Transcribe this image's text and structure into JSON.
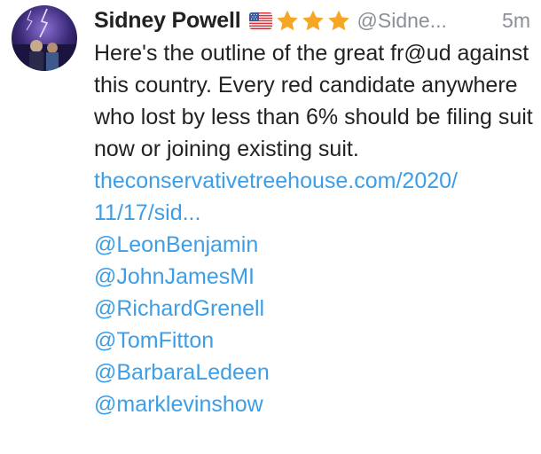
{
  "tweet": {
    "author_name": "Sidney Powell",
    "author_handle": "@Sidne...",
    "timestamp": "5m",
    "badges": {
      "flag": "us-flag-icon",
      "stars": [
        "star-icon",
        "star-icon",
        "star-icon"
      ],
      "star_color": "#f5a623"
    },
    "text": "Here's the outline of the great fr@ud against this country. Every red candidate anywhere who lost by less than 6% should be filing suit now or joining existing suit.",
    "url_line_1": "theconservativetreehouse.com/2020/",
    "url_line_2": "11/17/sid...",
    "mentions": [
      "@LeonBenjamin",
      "@JohnJamesMI",
      "@RichardGrenell",
      "@TomFitton",
      "@BarbaraLedeen",
      "@marklevinshow"
    ]
  },
  "colors": {
    "text": "#222222",
    "muted": "#8a8f98",
    "link": "#3c9ee6",
    "background": "#ffffff"
  }
}
